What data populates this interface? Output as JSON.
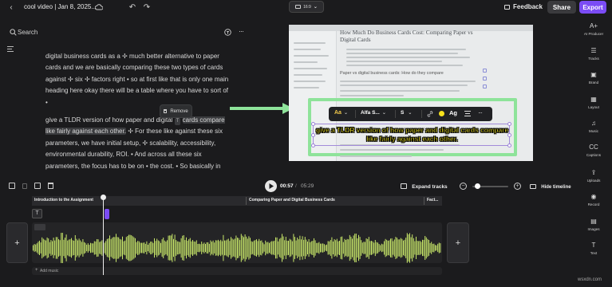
{
  "header": {
    "title": "cool video | Jan 8, 2025...",
    "aspect": "16:9",
    "feedback": "Feedback",
    "share": "Share",
    "export": "Export"
  },
  "search": {
    "placeholder": "Search"
  },
  "transcript": {
    "para1": "digital business cards as a ✢ much better alternative to paper cards and we are basically comparing these two types of cards against ✢ six ✢ factors right • so at first like that is only one main heading here okay there will be a table where you have to sort of •",
    "para2_a": "give a TLDR version of how paper and digital",
    "para2_chip": "T",
    "para2_b": "cards compare like fairly against each other.",
    "para2_c": "✢ For these like against these six parameters, we have initial setup, ✢ scalability, accessibility, environmental durability, ROI. • And across all these six parameters, the focus has to be on • the cost. • So basically in",
    "remove": "Remove"
  },
  "preview": {
    "doc_title": "How Much Do Business Cards Cost: Comparing Paper vs Digital Cards",
    "doc_sub": "Paper vs digital business cards: How do they compare",
    "caption": "give a TLDR version of how paper and digital cards compare like fairly against each other.",
    "toolbar": {
      "aa": "Aa",
      "font": "Alfa S...",
      "size": "S",
      "ag": "Ag",
      "accent": "#f6e11c"
    }
  },
  "rail": [
    {
      "icon": "A+",
      "label": "AI Producer"
    },
    {
      "icon": "☰",
      "label": "Tracks"
    },
    {
      "icon": "▣",
      "label": "Brand"
    },
    {
      "icon": "▦",
      "label": "Layout"
    },
    {
      "icon": "♫",
      "label": "Music"
    },
    {
      "icon": "CC",
      "label": "Captions"
    },
    {
      "icon": "⇪",
      "label": "Uploads"
    },
    {
      "icon": "◉",
      "label": "Record"
    },
    {
      "icon": "▤",
      "label": "Images"
    },
    {
      "icon": "T",
      "label": "Text"
    }
  ],
  "timeline": {
    "current": "00:57",
    "sep": "/",
    "total": "05:29",
    "expand": "Expand tracks",
    "hide": "Hide timeline",
    "zoom_level": 0.15,
    "chapters": [
      "Introduction to the Assignment",
      "Comparing Paper and Digital Business Cards",
      "Fact..."
    ],
    "add_music": "Add music"
  },
  "watermark": "wsxdn.com",
  "colors": {
    "accent_purple": "#7b4cf5",
    "waveform": "#c9e86a",
    "highlight_green": "#8ee39a"
  }
}
